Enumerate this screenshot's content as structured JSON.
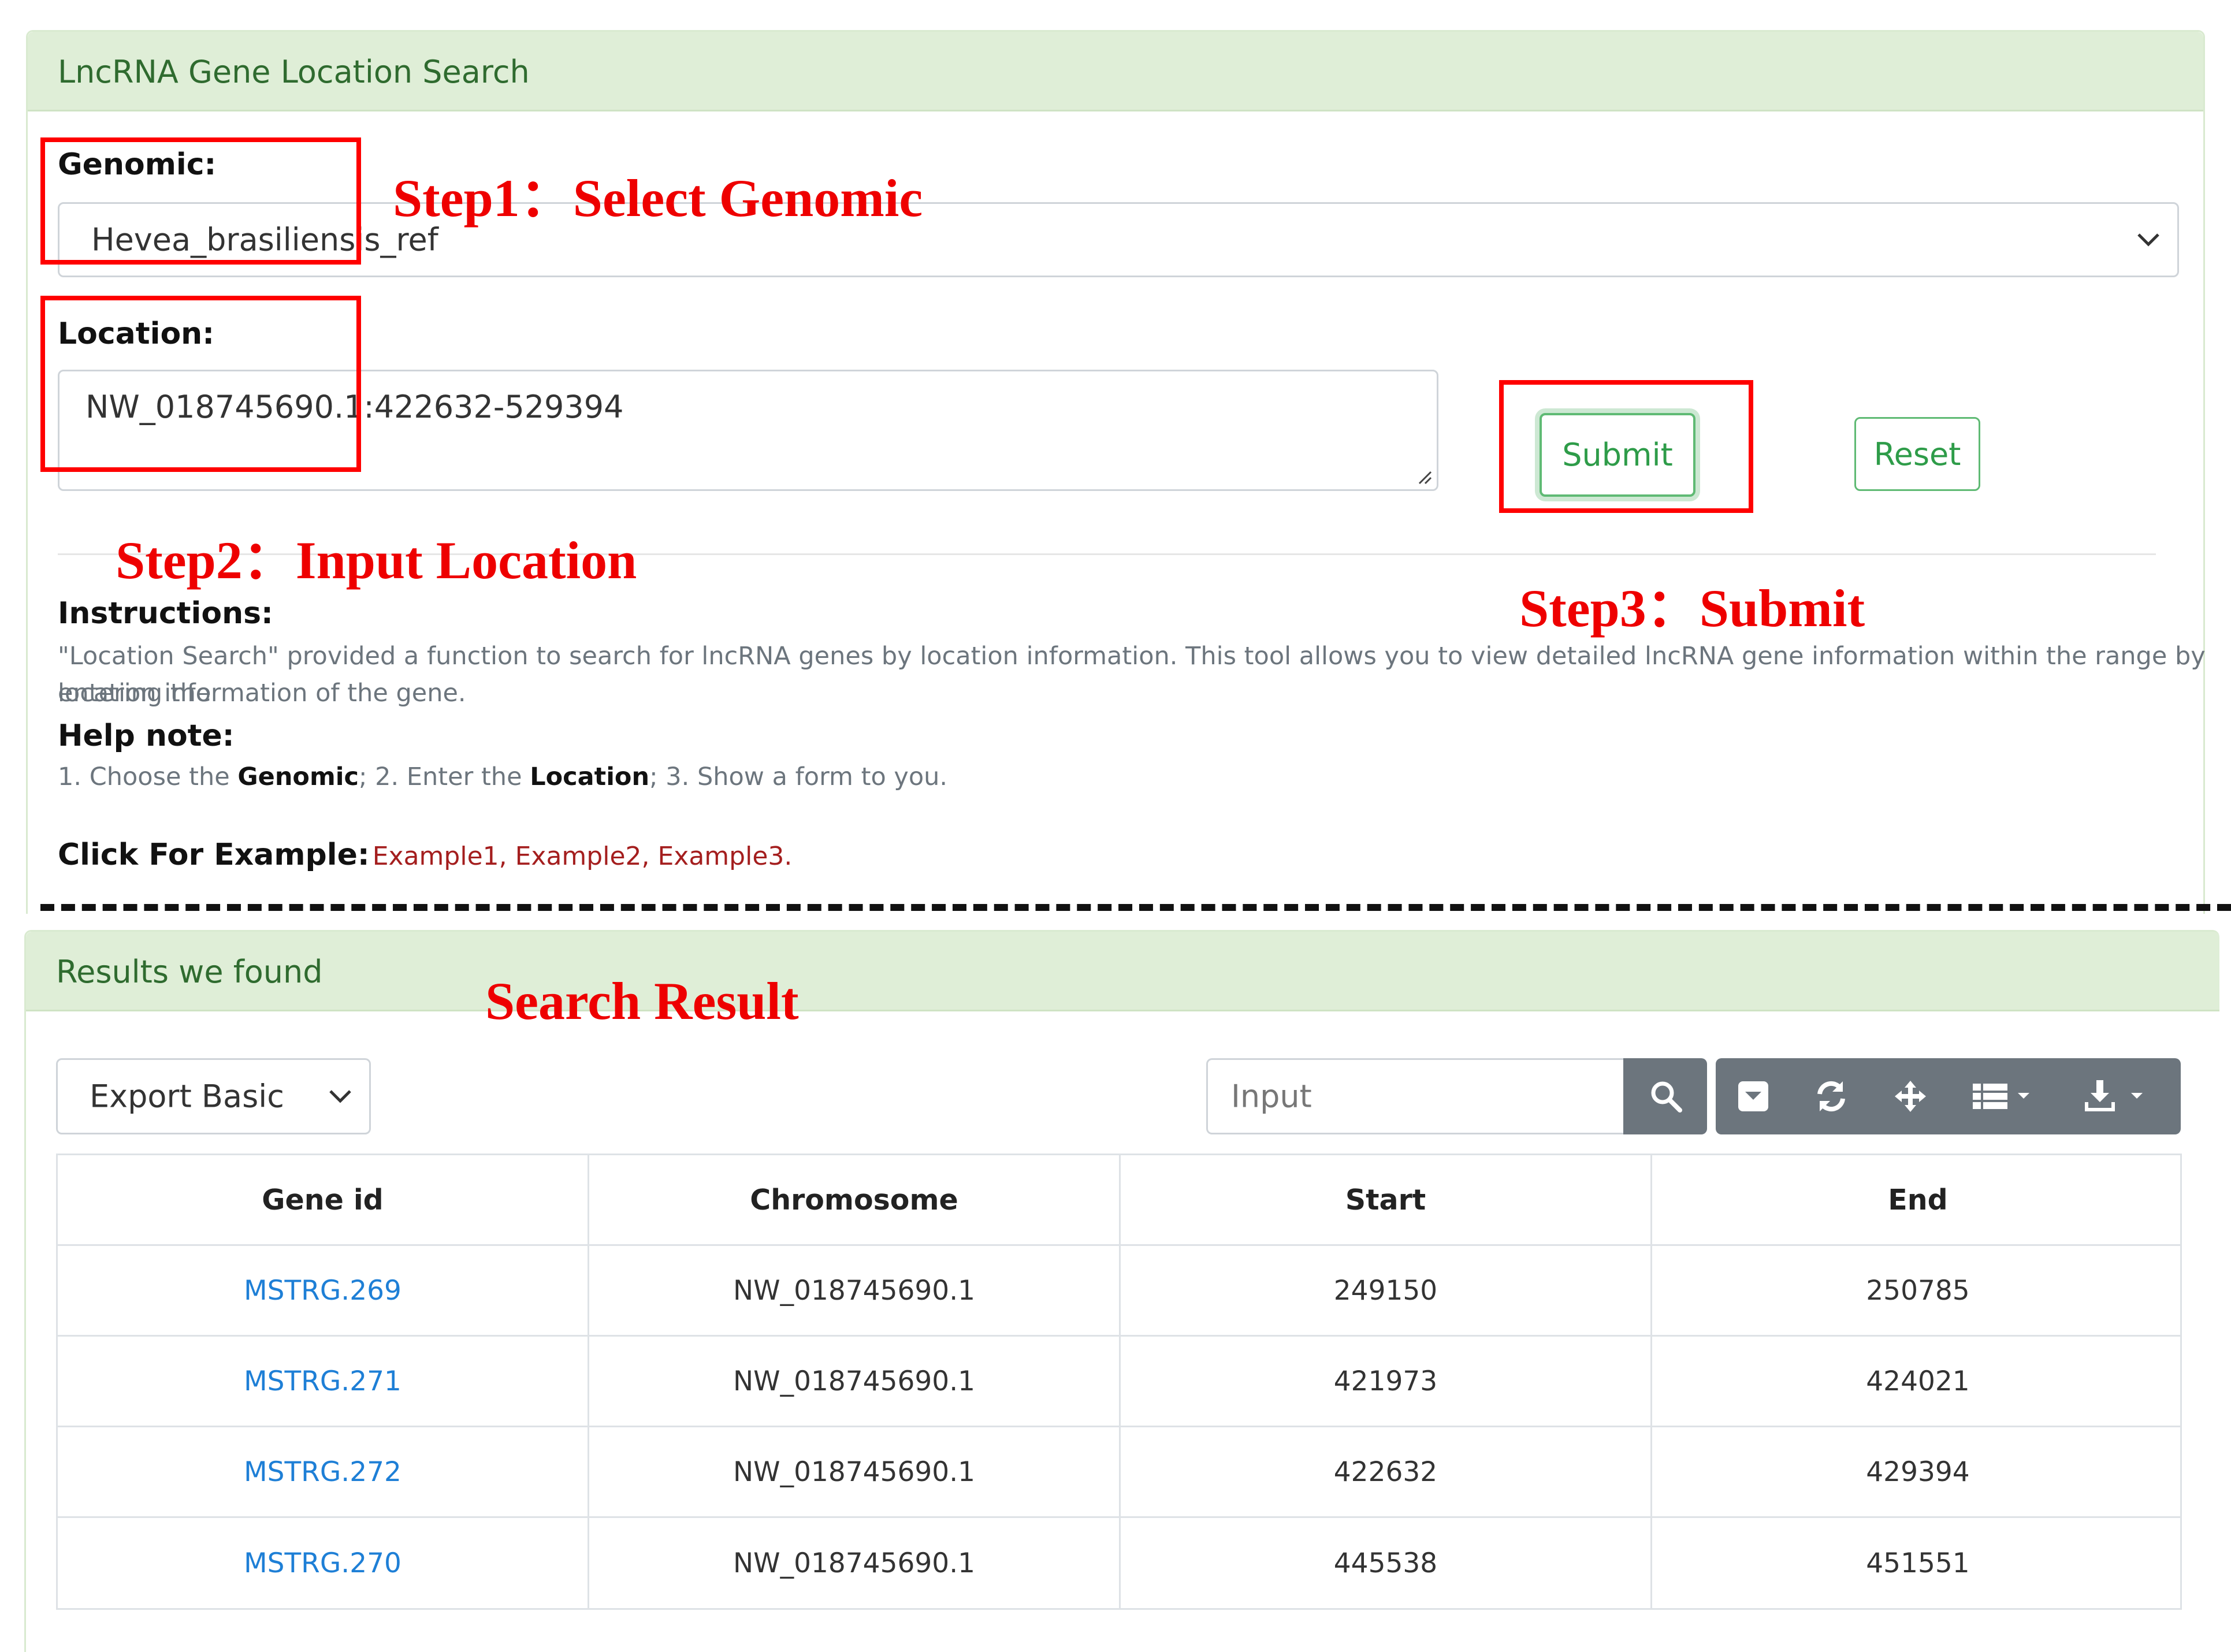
{
  "search_panel": {
    "title": "LncRNA Gene Location Search",
    "genomic_label": "Genomic:",
    "genomic_value": "Hevea_brasiliensis_ref",
    "location_label": "Location:",
    "location_value": "NW_018745690.1:422632-529394",
    "submit_label": "Submit",
    "reset_label": "Reset",
    "instructions_label": "Instructions:",
    "instructions_line1": "\"Location Search\" provided a function to search for lncRNA genes by location information. This tool allows you to view detailed lncRNA gene information within the range by entering the",
    "instructions_line2": "location information of the gene.",
    "help_label": "Help note:",
    "help_part1": "1. Choose the ",
    "help_genomic": "Genomic",
    "help_part2": "; 2. Enter the ",
    "help_location": "Location",
    "help_part3": "; 3. Show a form to you.",
    "example_label": "Click For Example:",
    "examples": [
      "Example1",
      "Example2",
      "Example3"
    ],
    "example_sep": ", ",
    "example_end": "."
  },
  "annotations": {
    "step1": "Step1：Select Genomic",
    "step2": "Step2：Input Location",
    "step3": "Step3：Submit",
    "search_result": "Search Result",
    "color": "#ee0000"
  },
  "results_panel": {
    "title": "Results we found",
    "export_select": "Export Basic",
    "search_placeholder": "Input",
    "toolbar_icons": [
      "search-icon",
      "toggle-icon",
      "refresh-icon",
      "move-icon",
      "columns-icon",
      "download-icon"
    ],
    "columns": [
      "Gene id",
      "Chromosome",
      "Start",
      "End"
    ],
    "rows": [
      [
        "MSTRG.269",
        "NW_018745690.1",
        "249150",
        "250785"
      ],
      [
        "MSTRG.271",
        "NW_018745690.1",
        "421973",
        "424021"
      ],
      [
        "MSTRG.272",
        "NW_018745690.1",
        "422632",
        "429394"
      ],
      [
        "MSTRG.270",
        "NW_018745690.1",
        "445538",
        "451551"
      ]
    ]
  },
  "colors": {
    "panel_header": "#dfeed7",
    "accent_green": "#2e9c49",
    "link_blue": "#1e7fd6",
    "example_red": "#a41e1e",
    "toolbar_gray": "#6c757d"
  }
}
